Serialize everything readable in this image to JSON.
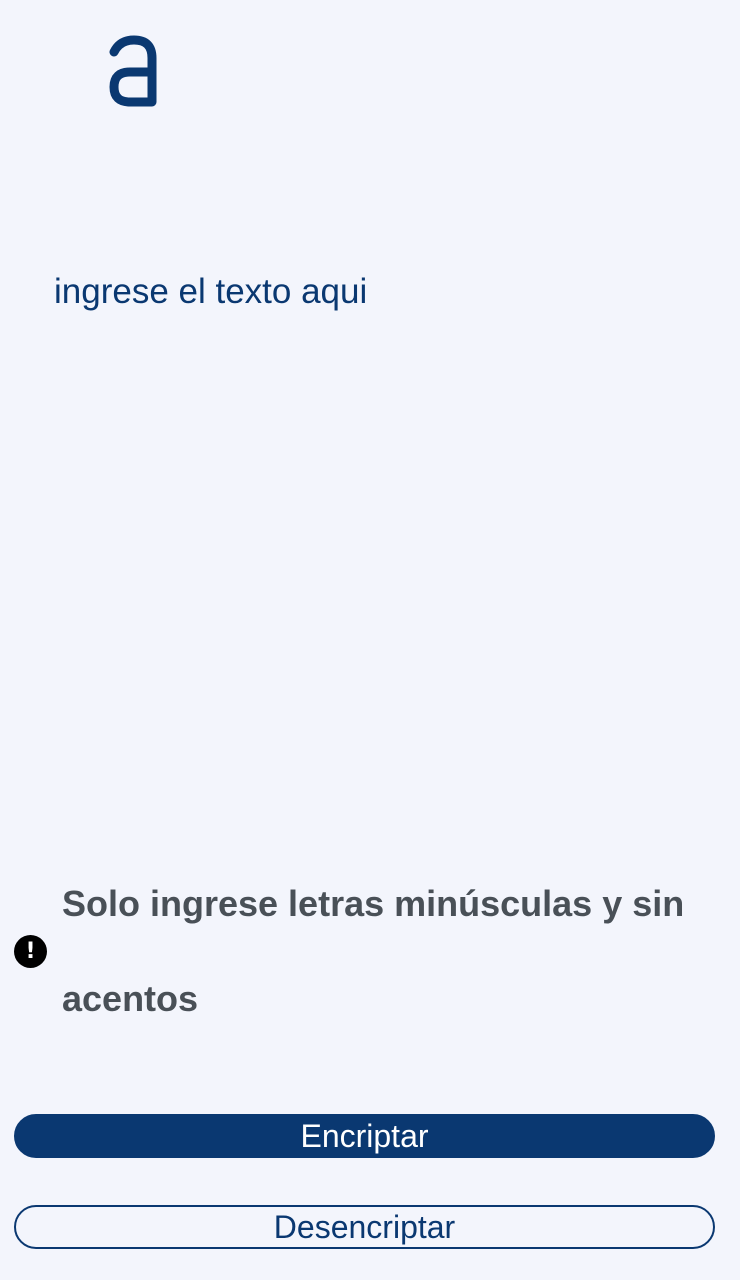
{
  "logo": {
    "glyph": "a-logo-icon",
    "color": "#0a3871"
  },
  "input": {
    "placeholder": "ingrese el texto aqui",
    "value": ""
  },
  "notice": {
    "icon": "exclamation-circle-icon",
    "icon_glyph": "!",
    "text": "Solo ingrese letras minúsculas y sin acentos"
  },
  "buttons": {
    "encrypt_label": "Encriptar",
    "decrypt_label": "Desencriptar"
  },
  "colors": {
    "background": "#f3f5fc",
    "primary": "#0a3871",
    "notice_text": "#495057"
  }
}
